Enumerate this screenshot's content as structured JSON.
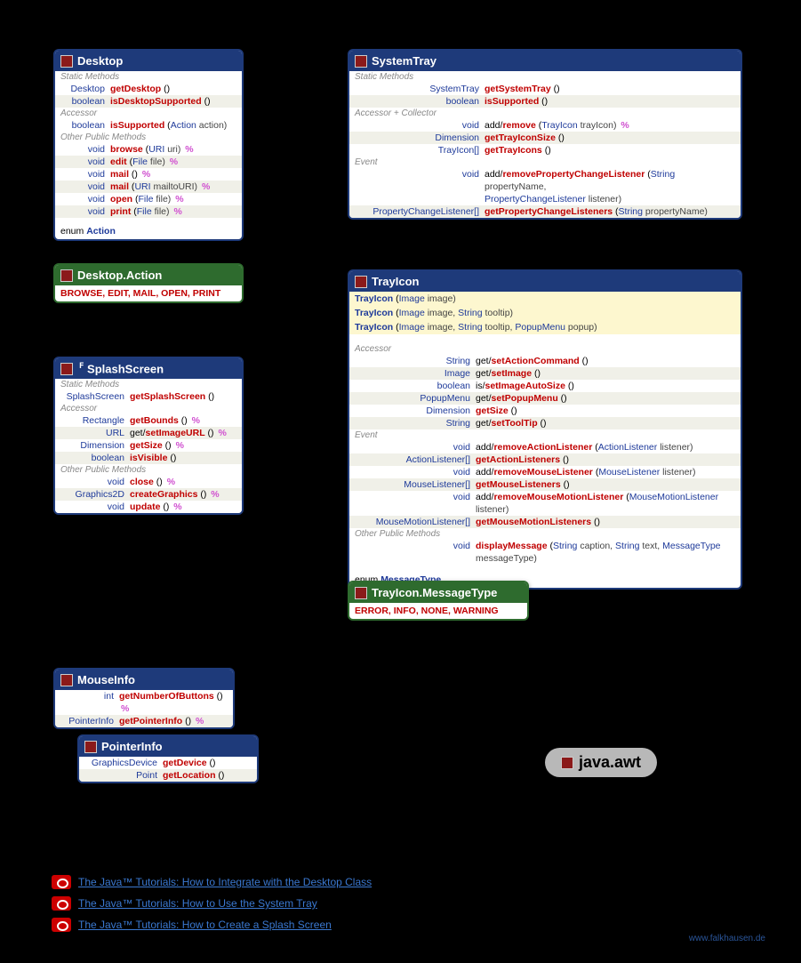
{
  "package": "java.awt",
  "credit": "www.falkhausen.de",
  "links": [
    {
      "label": "The Java™ Tutorials: How to Integrate with the Desktop Class"
    },
    {
      "label": "The Java™ Tutorials: How to Use the System Tray"
    },
    {
      "label": "The Java™ Tutorials: How to Create a Splash Screen"
    }
  ],
  "desktop": {
    "title": "Desktop",
    "sections": {
      "static": "Static Methods",
      "accessor": "Accessor",
      "other": "Other Public Methods"
    },
    "rows": {
      "r1": {
        "rt": "Desktop",
        "name": "getDesktop",
        "paren": " ()"
      },
      "r2": {
        "rt": "boolean",
        "name": "isDesktopSupported",
        "paren": " ()"
      },
      "r3": {
        "rt": "boolean",
        "name": "isSupported",
        "paren": " (",
        "ptype": "Action",
        "pname": " action)"
      },
      "r4": {
        "rt": "void",
        "name": "browse",
        "paren": " (",
        "ptype": "URI",
        "pname": " uri) ",
        "pct": "%"
      },
      "r5": {
        "rt": "void",
        "name": "edit",
        "paren": " (",
        "ptype": "File",
        "pname": " file) ",
        "pct": "%"
      },
      "r6": {
        "rt": "void",
        "name": "mail",
        "paren": " () ",
        "pct": "%"
      },
      "r7": {
        "rt": "void",
        "name": "mail",
        "paren": " (",
        "ptype": "URI",
        "pname": " mailtoURI) ",
        "pct": "%"
      },
      "r8": {
        "rt": "void",
        "name": "open",
        "paren": " (",
        "ptype": "File",
        "pname": " file) ",
        "pct": "%"
      },
      "r9": {
        "rt": "void",
        "name": "print",
        "paren": " (",
        "ptype": "File",
        "pname": " file) ",
        "pct": "%"
      }
    },
    "enumref": {
      "kw": "enum ",
      "name": "Action"
    }
  },
  "desktop_action": {
    "title": "Desktop.Action",
    "values": "BROWSE, EDIT, MAIL, OPEN, PRINT"
  },
  "splash": {
    "title": "SplashScreen",
    "final_marker": "F",
    "sections": {
      "static": "Static Methods",
      "accessor": "Accessor",
      "other": "Other Public Methods"
    },
    "rows": {
      "r1": {
        "rt": "SplashScreen",
        "name": "getSplashScreen",
        "paren": " ()"
      },
      "r2": {
        "rt": "Rectangle",
        "name": "getBounds",
        "paren": " () ",
        "pct": "%"
      },
      "r3": {
        "rt": "URL",
        "pre": "get/",
        "name": "setImageURL",
        "paren": " () ",
        "pct": "%"
      },
      "r4": {
        "rt": "Dimension",
        "name": "getSize",
        "paren": " () ",
        "pct": "%"
      },
      "r5": {
        "rt": "boolean",
        "name": "isVisible",
        "paren": " ()"
      },
      "r6": {
        "rt": "void",
        "name": "close",
        "paren": " () ",
        "pct": "%"
      },
      "r7": {
        "rt": "Graphics2D",
        "name": "createGraphics",
        "paren": " () ",
        "pct": "%"
      },
      "r8": {
        "rt": "void",
        "name": "update",
        "paren": " () ",
        "pct": "%"
      }
    }
  },
  "systray": {
    "title": "SystemTray",
    "sections": {
      "static": "Static Methods",
      "accessor": "Accessor + Collector",
      "event": "Event"
    },
    "rows": {
      "r1": {
        "rt": "SystemTray",
        "name": "getSystemTray",
        "paren": " ()"
      },
      "r2": {
        "rt": "boolean",
        "name": "isSupported",
        "paren": " ()"
      },
      "r3": {
        "rt": "void",
        "pre": "add/",
        "name": "remove",
        "paren": " (",
        "ptype": "TrayIcon",
        "pname": " trayIcon) ",
        "pct": "%"
      },
      "r4": {
        "rt": "Dimension",
        "name": "getTrayIconSize",
        "paren": " ()"
      },
      "r5": {
        "rt": "TrayIcon[]",
        "name": "getTrayIcons",
        "paren": " ()"
      },
      "r6": {
        "rt": "void",
        "pre": "add/",
        "name": "removePropertyChangeListener",
        "paren": " (",
        "ptype": "String",
        "pname": " propertyName,"
      },
      "r6b": {
        "ptype": "PropertyChangeListener",
        "pname": " listener)"
      },
      "r7": {
        "rt": "PropertyChangeListener[]",
        "name": "getPropertyChangeListeners",
        "paren": " (",
        "ptype": "String",
        "pname": " propertyName)"
      }
    }
  },
  "trayicon": {
    "title": "TrayIcon",
    "cons": {
      "c1": {
        "name": "TrayIcon",
        "paren": " (",
        "p": "Image image)"
      },
      "c2": {
        "name": "TrayIcon",
        "paren": " (",
        "p": "Image image, String tooltip)"
      },
      "c3": {
        "name": "TrayIcon",
        "paren": " (",
        "p": "Image image, String tooltip, PopupMenu popup)"
      }
    },
    "sections": {
      "accessor": "Accessor",
      "event": "Event",
      "other": "Other Public Methods"
    },
    "rows": {
      "a1": {
        "rt": "String",
        "pre": "get/",
        "name": "setActionCommand",
        "paren": " ()"
      },
      "a2": {
        "rt": "Image",
        "pre": "get/",
        "name": "setImage",
        "paren": " ()"
      },
      "a3": {
        "rt": "boolean",
        "pre": "is/",
        "name": "setImageAutoSize",
        "paren": " ()"
      },
      "a4": {
        "rt": "PopupMenu",
        "pre": "get/",
        "name": "setPopupMenu",
        "paren": " ()"
      },
      "a5": {
        "rt": "Dimension",
        "name": "getSize",
        "paren": " ()"
      },
      "a6": {
        "rt": "String",
        "pre": "get/",
        "name": "setToolTip",
        "paren": " ()"
      },
      "e1": {
        "rt": "void",
        "pre": "add/",
        "name": "removeActionListener",
        "paren": " (",
        "ptype": "ActionListener",
        "pname": " listener)"
      },
      "e2": {
        "rt": "ActionListener[]",
        "name": "getActionListeners",
        "paren": " ()"
      },
      "e3": {
        "rt": "void",
        "pre": "add/",
        "name": "removeMouseListener",
        "paren": " (",
        "ptype": "MouseListener",
        "pname": " listener)"
      },
      "e4": {
        "rt": "MouseListener[]",
        "name": "getMouseListeners",
        "paren": " ()"
      },
      "e5": {
        "rt": "void",
        "pre": "add/",
        "name": "removeMouseMotionListener",
        "paren": " (",
        "ptype": "MouseMotionListener",
        "pname": " listener)"
      },
      "e6": {
        "rt": "MouseMotionListener[]",
        "name": "getMouseMotionListeners",
        "paren": " ()"
      },
      "o1": {
        "rt": "void",
        "name": "displayMessage",
        "paren": " (",
        "ptype": "String",
        "pname": " caption, ",
        "ptype2": "String",
        "pname2": " text, ",
        "ptype3": "MessageType",
        "pname3": " messageType)"
      }
    },
    "enumref": {
      "kw": "enum ",
      "name": "MessageType"
    }
  },
  "trayicon_mt": {
    "title": "TrayIcon.MessageType",
    "values": "ERROR, INFO, NONE, WARNING"
  },
  "mouseinfo": {
    "title": "MouseInfo",
    "rows": {
      "r1": {
        "rt": "int",
        "name": "getNumberOfButtons",
        "paren": " () ",
        "pct": "%"
      },
      "r2": {
        "rt": "PointerInfo",
        "name": "getPointerInfo",
        "paren": " () ",
        "pct": "%"
      }
    }
  },
  "pointerinfo": {
    "title": "PointerInfo",
    "rows": {
      "r1": {
        "rt": "GraphicsDevice",
        "name": "getDevice",
        "paren": " ()"
      },
      "r2": {
        "rt": "Point",
        "name": "getLocation",
        "paren": " ()"
      }
    }
  }
}
